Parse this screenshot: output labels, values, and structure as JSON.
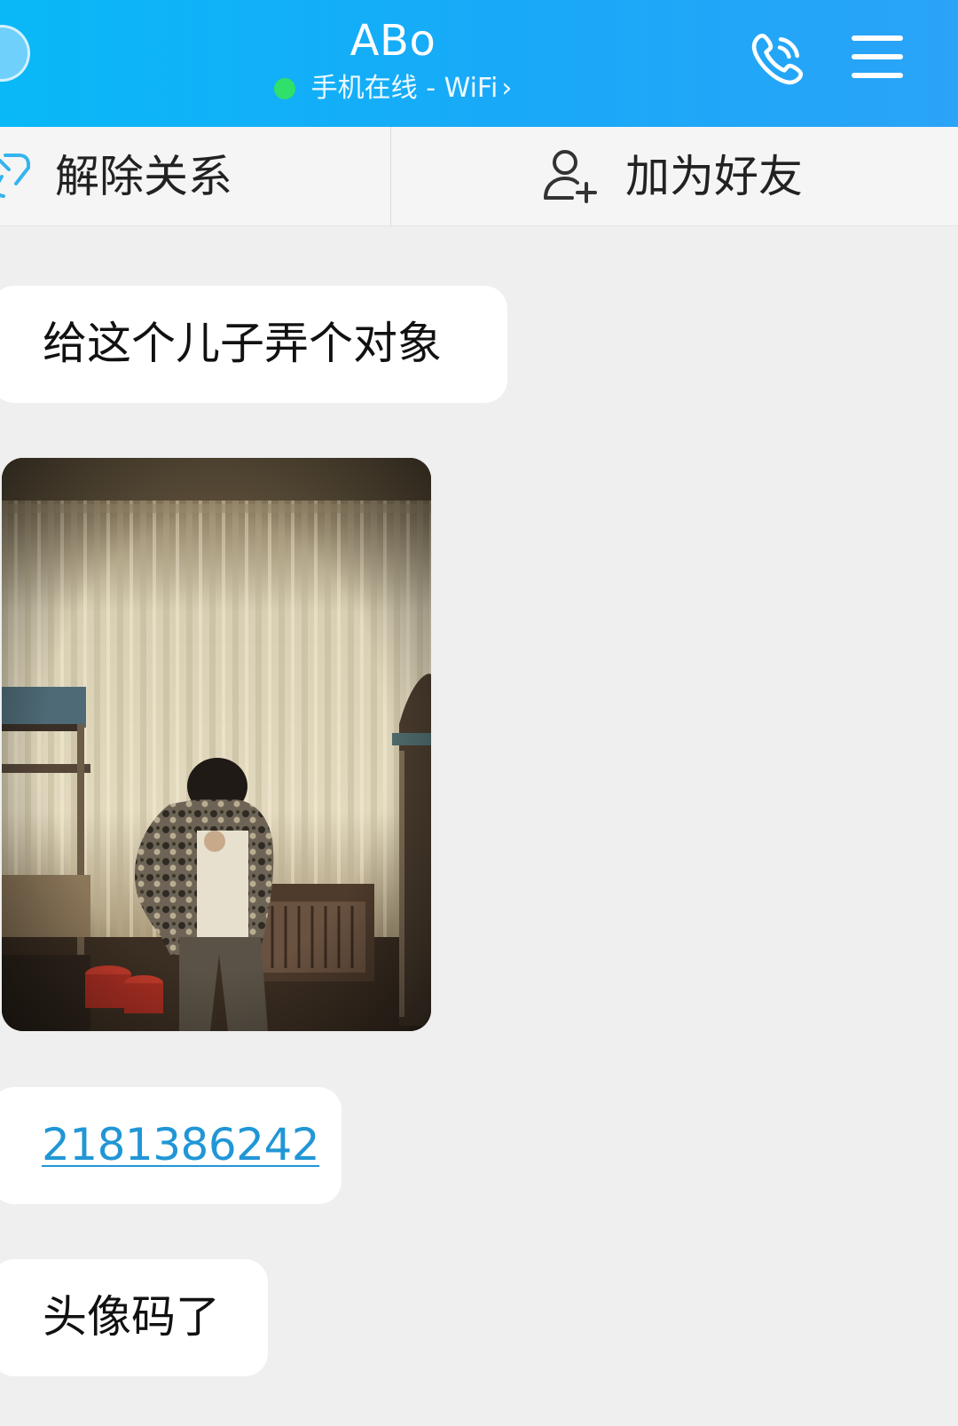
{
  "header": {
    "title": "ABo",
    "subtitle": "手机在线 - WiFi",
    "colors": {
      "bar": "#19a9f8",
      "online_dot": "#2fe06a"
    },
    "icons": [
      "back-avatar",
      "phone-icon",
      "menu-icon",
      "chevron-right-icon"
    ]
  },
  "action_bar": {
    "left_label": "解除关系",
    "right_label": "加为好友",
    "icons": [
      "unlink-icon",
      "add-user-icon"
    ]
  },
  "messages": [
    {
      "type": "text",
      "text": "给这个儿子弄个对象"
    },
    {
      "type": "image",
      "description": "photo"
    },
    {
      "type": "link",
      "text": "2181386242",
      "color": "#2196d6"
    },
    {
      "type": "text",
      "text": "头像码了"
    }
  ]
}
